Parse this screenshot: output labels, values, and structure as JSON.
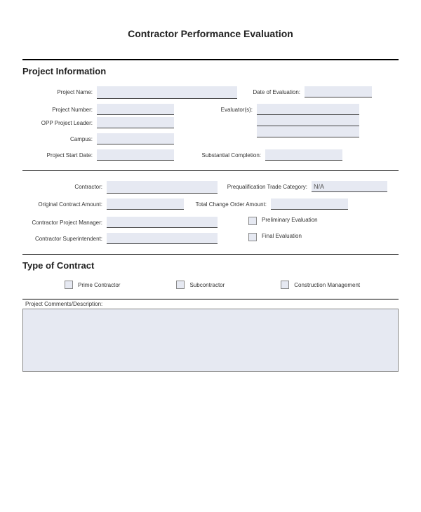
{
  "title": "Contractor Performance Evaluation",
  "section1": {
    "header": "Project Information",
    "project_name_label": "Project Name:",
    "project_name_value": "",
    "date_eval_label": "Date of Evaluation:",
    "date_eval_value": "",
    "project_number_label": "Project Number:",
    "project_number_value": "",
    "evaluators_label": "Evaluator(s):",
    "evaluators_value": "",
    "opp_leader_label": "OPP Project Leader:",
    "opp_leader_value": "",
    "campus_label": "Campus:",
    "campus_value": "",
    "start_date_label": "Project Start Date:",
    "start_date_value": "",
    "subst_completion_label": "Substantial Completion:",
    "subst_completion_value": ""
  },
  "section2": {
    "contractor_label": "Contractor:",
    "contractor_value": "",
    "prequal_label": "Prequalification Trade Category:",
    "prequal_value": "N/A",
    "orig_amount_label": "Original Contract Amount:",
    "orig_amount_value": "",
    "change_order_label": "Total Change Order Amount:",
    "change_order_value": "",
    "pm_label": "Contractor Project Manager:",
    "pm_value": "",
    "super_label": "Contractor Superintendent:",
    "super_value": "",
    "preliminary_label": "Preliminary Evaluation",
    "final_label": "Final Evaluation"
  },
  "section3": {
    "header": "Type of Contract",
    "prime_label": "Prime Contractor",
    "sub_label": "Subcontractor",
    "construction_label": "Construction Management",
    "comments_label": "Project Comments/Description:",
    "comments_value": ""
  }
}
